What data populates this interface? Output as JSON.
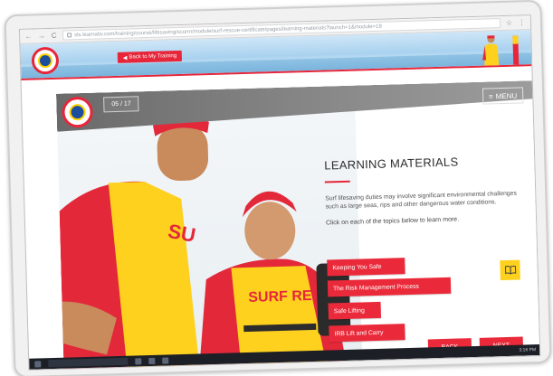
{
  "browser": {
    "nav_back": "←",
    "nav_forward": "→",
    "nav_reload": "C",
    "url": "sls.learnativ.com/training/course/lifesaving/scorm/module/surf-rescue-certificate/pages/learning-materials?launch=1&module=19",
    "star": "☆",
    "more": "⋮"
  },
  "site_header": {
    "back_button": {
      "icon": "arrow-left-icon",
      "label": "Back to My Training"
    }
  },
  "module": {
    "page_counter": "05 / 17",
    "menu": {
      "icon": "hamburger-icon",
      "label": "MENU"
    },
    "title": "LEARNING MATERIALS",
    "body": "Surf lifesaving duties may involve significant environmental challenges such as large seas, rips and other dangerous water conditions.",
    "instruction": "Click on each of the topics below to learn more.",
    "topics": [
      {
        "label": "Keeping You Safe"
      },
      {
        "label": "The Risk Management Process"
      },
      {
        "label": "Safe Lifting"
      },
      {
        "label": "IRB Lift and Carry"
      }
    ],
    "book_icon": "book-icon",
    "back_label": "BACK",
    "next_label": "NEXT"
  },
  "photo": {
    "shirt_text_1": "SU",
    "shirt_text_2": "SURF RESC"
  },
  "taskbar": {
    "clock": "3:16 PM"
  },
  "colors": {
    "accent_red": "#e7263a",
    "accent_yellow": "#ffd11f",
    "header_grey": "#7a7a7a"
  }
}
